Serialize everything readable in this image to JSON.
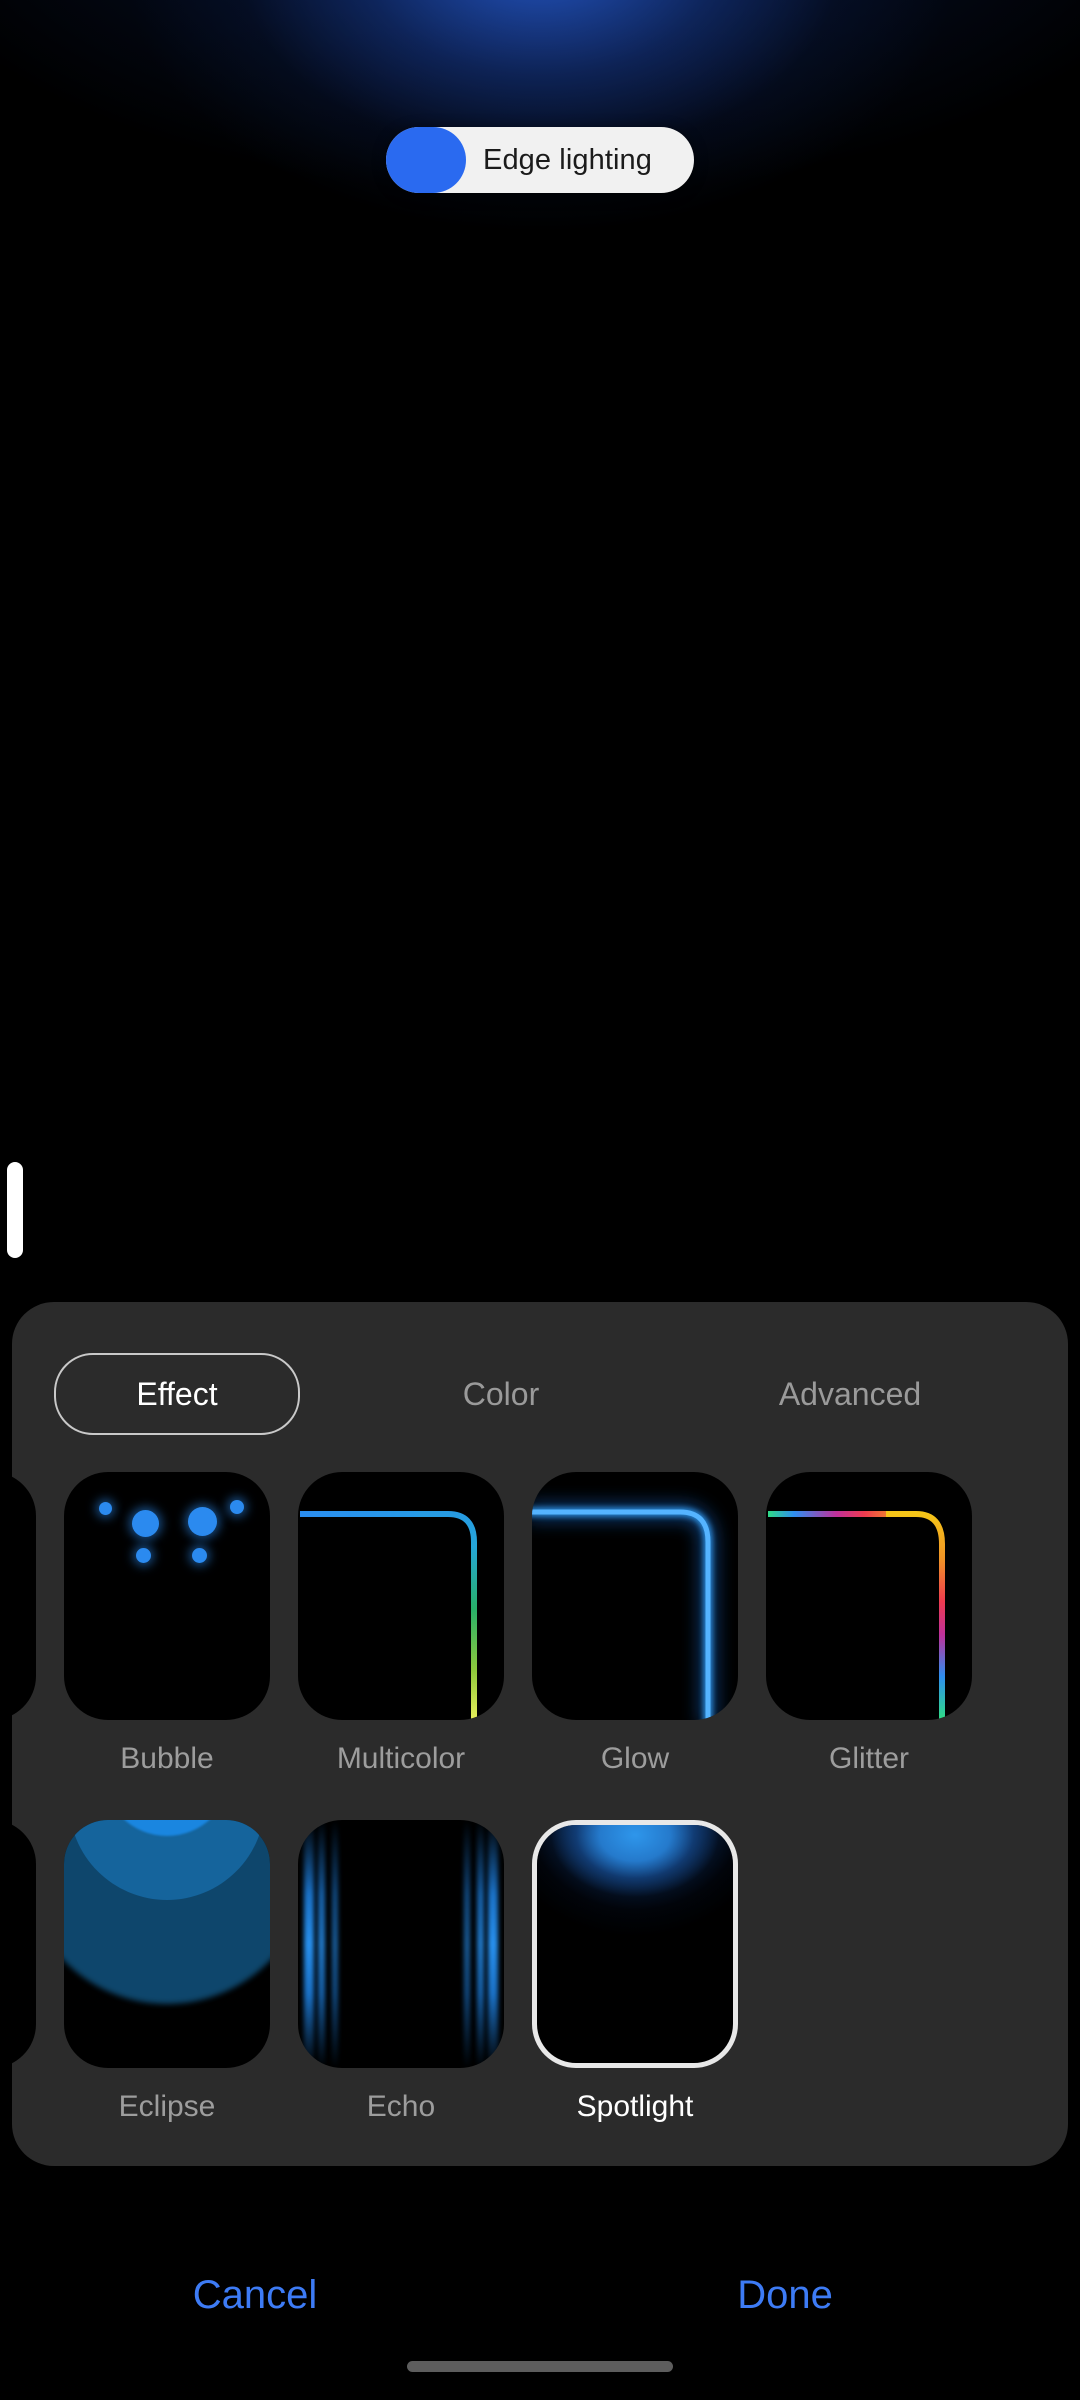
{
  "header": {
    "toggle": {
      "label": "Edge lighting",
      "state": "on",
      "accent_color": "#2a6af0",
      "pill_bg": "#f1f1f1"
    }
  },
  "edge_handle": {
    "name": "edge-panel-handle",
    "color": "#ffffff"
  },
  "panel": {
    "background": "#2b2b2b",
    "tabs": [
      {
        "label": "Effect",
        "selected": true
      },
      {
        "label": "Color",
        "selected": false
      },
      {
        "label": "Advanced",
        "selected": false
      }
    ],
    "effects": [
      {
        "label": "Bubble",
        "selected": false,
        "art": "bubble"
      },
      {
        "label": "Multicolor",
        "selected": false,
        "art": "multicolor"
      },
      {
        "label": "Glow",
        "selected": false,
        "art": "glow"
      },
      {
        "label": "Glitter",
        "selected": false,
        "art": "glitter"
      },
      {
        "label": "Eclipse",
        "selected": false,
        "art": "eclipse"
      },
      {
        "label": "Echo",
        "selected": false,
        "art": "echo"
      },
      {
        "label": "Spotlight",
        "selected": true,
        "art": "spotlight"
      }
    ]
  },
  "actions": {
    "cancel_label": "Cancel",
    "done_label": "Done",
    "link_color": "#3d7bf5"
  },
  "system": {
    "nav_pill_color": "#5d5d5d"
  },
  "colors": {
    "accent_blue": "#2a6af0",
    "glow_blue": "#2e96eb",
    "panel_bg": "#2b2b2b",
    "screen_bg": "#000000",
    "label_muted": "#9d9d9d",
    "label_selected": "#ffffff"
  }
}
